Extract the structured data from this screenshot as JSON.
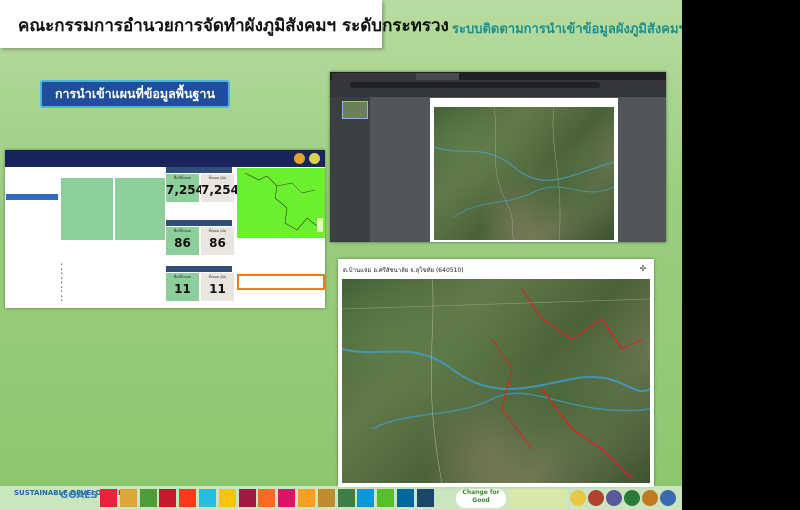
{
  "slide": {
    "title": "คณะกรรมการอำนวยการจัดทำผังภูมิสังคมฯ ระดับกระทรวง",
    "subtitle": "ระบบติดตามการนำเข้าข้อมูลผังภูมิสังคมฯ",
    "section_button": "การนำเข้าแผนที่ข้อมูลพื้นฐาน"
  },
  "dashboard": {
    "stats": [
      {
        "caption": "พื้นที่ทั้งหมด",
        "value": "7,254"
      },
      {
        "caption": "ทั้งหมด (ผัง)",
        "value": "7,254"
      },
      {
        "caption": "พื้นที่ทั้งหมด",
        "value": "86"
      },
      {
        "caption": "ทั้งหมด (ผัง)",
        "value": "86"
      },
      {
        "caption": "พื้นที่ทั้งหมด",
        "value": "11"
      },
      {
        "caption": "ทั้งหมด (ผัง)",
        "value": "11"
      }
    ]
  },
  "map_document": {
    "caption": "ต.บ้านแจ่ม อ.ศรีสัชนาลัย จ.สุโขทัย (640510)"
  },
  "footer": {
    "sdg_text": "SUSTAINABLE DEVELOPMENT",
    "goals_text": "GOALS",
    "change_for_good": "Change for Good",
    "colors": [
      "#e5243b",
      "#dda63a",
      "#4c9f38",
      "#c5192d",
      "#ff3a21",
      "#26bde2",
      "#fcc30b",
      "#a21942",
      "#fd6925",
      "#dd1367",
      "#fd9d24",
      "#bf8b2e",
      "#3f7e44",
      "#0a97d9",
      "#56c02b",
      "#00689d",
      "#19486a"
    ]
  }
}
